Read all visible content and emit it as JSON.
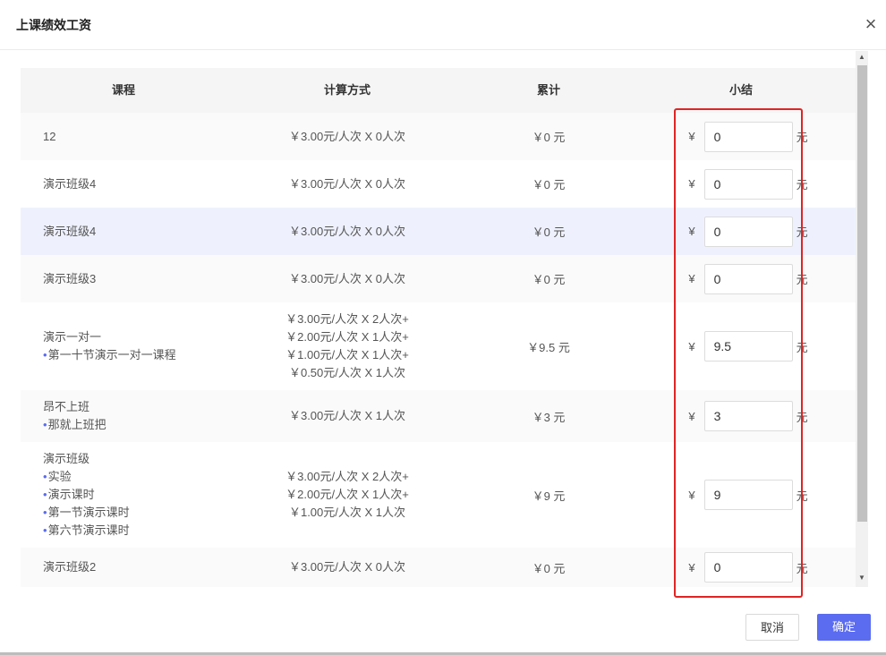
{
  "dialog": {
    "title": "上课绩效工资",
    "close_icon": "close-icon"
  },
  "table": {
    "headers": [
      "课程",
      "计算方式",
      "累计",
      "小结"
    ],
    "currency": "¥",
    "unit": "元",
    "rows": [
      {
        "course": "12",
        "subs": [],
        "calc": [
          "￥3.00元/人次 X 0人次"
        ],
        "total": "￥0 元",
        "value": "0"
      },
      {
        "course": "演示班级4",
        "subs": [],
        "calc": [
          "￥3.00元/人次 X 0人次"
        ],
        "total": "￥0 元",
        "value": "0"
      },
      {
        "course": "演示班级4",
        "subs": [],
        "calc": [
          "￥3.00元/人次 X 0人次"
        ],
        "total": "￥0 元",
        "value": "0"
      },
      {
        "course": "演示班级3",
        "subs": [],
        "calc": [
          "￥3.00元/人次 X 0人次"
        ],
        "total": "￥0 元",
        "value": "0"
      },
      {
        "course": "演示一对一",
        "subs": [
          "第一十节演示一对一课程"
        ],
        "calc": [
          "￥3.00元/人次 X 2人次+",
          "￥2.00元/人次 X 1人次+",
          "￥1.00元/人次 X 1人次+",
          "￥0.50元/人次 X 1人次"
        ],
        "total": "￥9.5 元",
        "value": "9.5"
      },
      {
        "course": "昂不上班",
        "subs": [
          "那就上班把"
        ],
        "calc": [
          "￥3.00元/人次 X 1人次"
        ],
        "total": "￥3 元",
        "value": "3"
      },
      {
        "course": "演示班级",
        "subs": [
          "实验",
          "演示课时",
          "第一节演示课时",
          "第六节演示课时"
        ],
        "calc": [
          "￥3.00元/人次 X 2人次+",
          "￥2.00元/人次 X 1人次+",
          "￥1.00元/人次 X 1人次"
        ],
        "total": "￥9 元",
        "value": "9"
      },
      {
        "course": "演示班级2",
        "subs": [],
        "calc": [
          "￥3.00元/人次 X 0人次"
        ],
        "total": "￥0 元",
        "value": "0"
      }
    ]
  },
  "footer": {
    "cancel_label": "取消",
    "confirm_label": "确定"
  },
  "colors": {
    "accent": "#5b6cf0",
    "highlight_box": "#e02424",
    "row_highlight": "#eef1fd"
  }
}
